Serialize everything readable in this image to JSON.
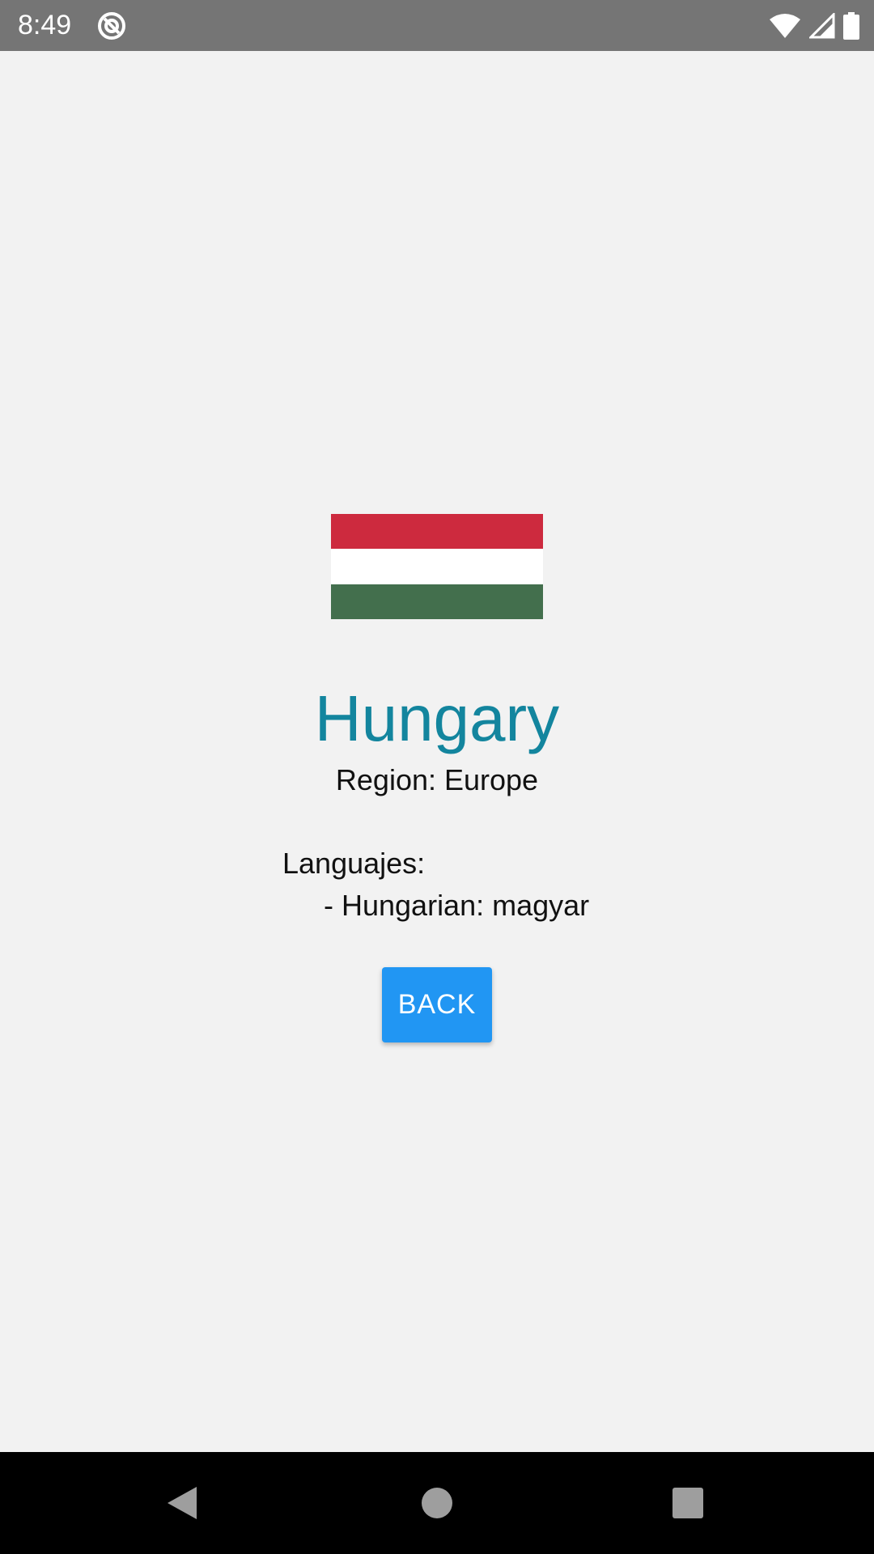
{
  "status_bar": {
    "time": "8:49",
    "icons": [
      "app-notification-icon",
      "wifi-icon",
      "cellular-signal-icon",
      "battery-icon"
    ]
  },
  "country": {
    "flag_colors": [
      "#cd2a3e",
      "#ffffff",
      "#436f4d"
    ],
    "name": "Hungary",
    "region": "Region: Europe"
  },
  "languages": {
    "title": "Languajes:",
    "items": [
      "- Hungarian: magyar"
    ]
  },
  "actions": {
    "back_label": "BACK"
  },
  "nav_bar": {
    "icons": [
      "back-triangle-icon",
      "home-circle-icon",
      "recents-square-icon"
    ]
  },
  "colors": {
    "accent": "#13859e",
    "button": "#2196f3",
    "status_bar": "#757575",
    "background": "#f2f2f2"
  }
}
